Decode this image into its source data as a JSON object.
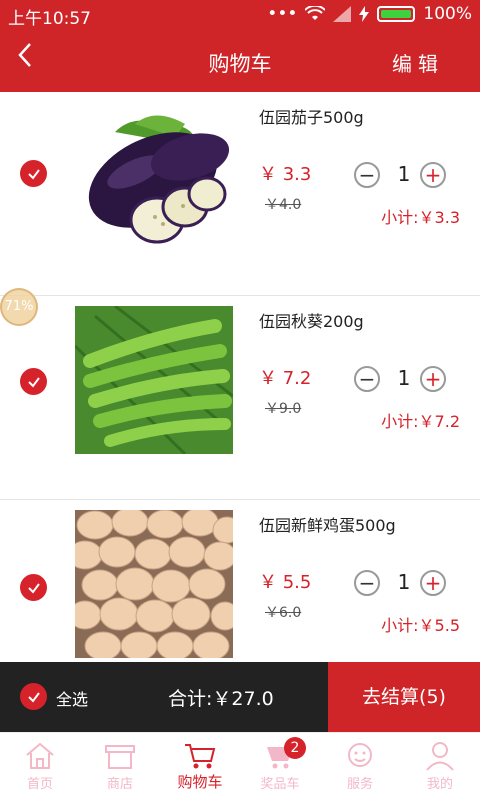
{
  "status_bar": {
    "time": "上午10:57",
    "battery": "100%",
    "icons": [
      "dots-icon",
      "wifi-icon",
      "signal-icon",
      "charging-icon",
      "battery-icon"
    ]
  },
  "header": {
    "title": "购物车",
    "edit_label": "编辑"
  },
  "items": [
    {
      "name": "伍园茄子500g",
      "price": "￥ 3.3",
      "old_price": "￥4.0",
      "quantity": "1",
      "subtotal": "小计:￥3.3",
      "checked": true,
      "image": "eggplant"
    },
    {
      "name": "伍园秋葵200g",
      "price": "￥ 7.2",
      "old_price": "￥9.0",
      "quantity": "1",
      "subtotal": "小计:￥7.2",
      "checked": true,
      "image": "okra"
    },
    {
      "name": "伍园新鲜鸡蛋500g",
      "price": "￥ 5.5",
      "old_price": "￥6.0",
      "quantity": "1",
      "subtotal": "小计:￥5.5",
      "checked": true,
      "image": "eggs"
    }
  ],
  "floating_badge": "71%",
  "footer": {
    "select_all": "全选",
    "total": "合计:￥27.0",
    "checkout": "去结算(5)"
  },
  "tabs": [
    {
      "label": "首页",
      "icon": "home-icon",
      "active": false
    },
    {
      "label": "商店",
      "icon": "shop-icon",
      "active": false
    },
    {
      "label": "购物车",
      "icon": "cart-icon",
      "active": true
    },
    {
      "label": "奖品车",
      "icon": "prize-cart-icon",
      "active": false,
      "badge": "2"
    },
    {
      "label": "服务",
      "icon": "service-icon",
      "active": false
    },
    {
      "label": "我的",
      "icon": "user-icon",
      "active": false
    }
  ],
  "colors": {
    "brand_red": "#cf2428",
    "price_red": "#d6222a",
    "tab_inactive": "#f2b8c8",
    "bottom_bar": "#222222"
  }
}
